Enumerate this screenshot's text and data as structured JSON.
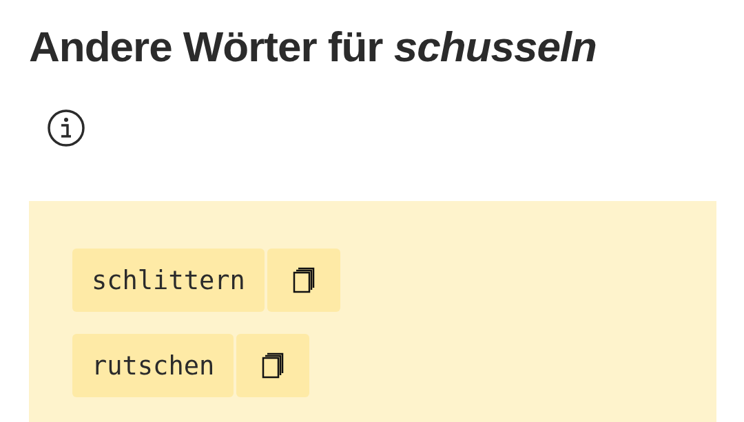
{
  "heading": "Andere Wörter für *schusseln*",
  "synonyms": [
    {
      "word": "schlittern"
    },
    {
      "word": "rutschen"
    }
  ]
}
